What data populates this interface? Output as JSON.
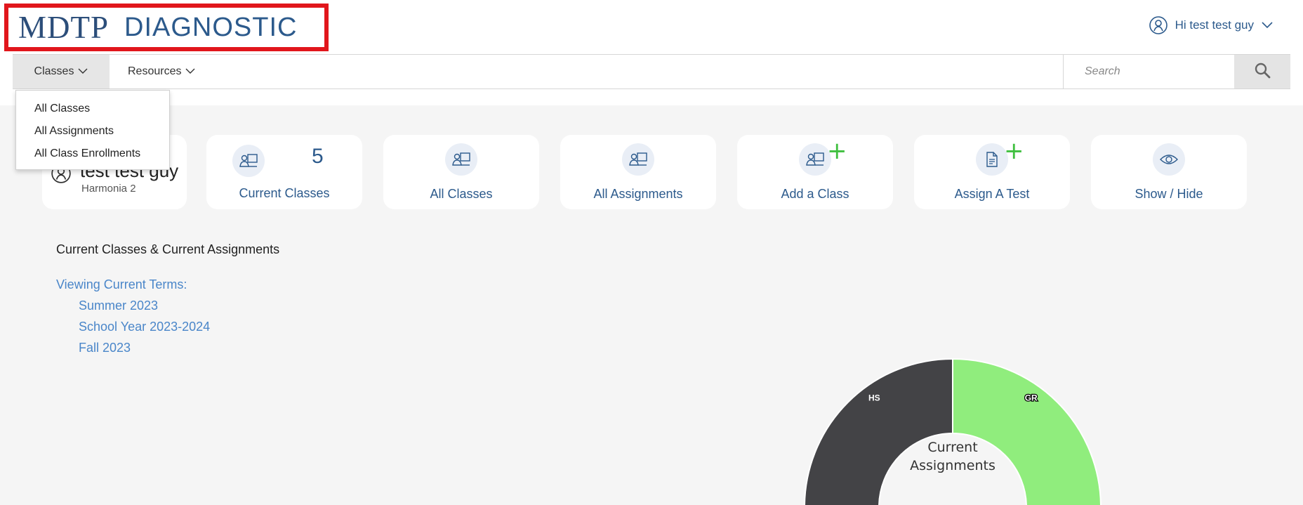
{
  "header": {
    "logo_mdtp": "MDTP",
    "logo_diagnostic": "DIAGNOSTIC",
    "greeting": "Hi test test guy",
    "user_icon": "user-circle-icon",
    "chevron_icon": "chevron-down-icon",
    "highlight_color": "#e1161c"
  },
  "nav": {
    "classes_label": "Classes",
    "resources_label": "Resources",
    "search_placeholder": "Search",
    "search_icon": "search-icon"
  },
  "dropdown": {
    "items": [
      "All Classes",
      "All Assignments",
      "All Class Enrollments"
    ]
  },
  "profile": {
    "name": "test test guy",
    "school": "Harmonia 2"
  },
  "cards": {
    "current_classes": {
      "count": "5",
      "label": "Current Classes"
    },
    "all_classes": {
      "label": "All Classes"
    },
    "all_assignments": {
      "label": "All Assignments"
    },
    "add_class": {
      "label": "Add a Class"
    },
    "assign_test": {
      "label": "Assign A Test"
    },
    "show_hide": {
      "label": "Show / Hide"
    }
  },
  "section": {
    "title": "Current Classes & Current Assignments",
    "terms_label": "Viewing Current Terms:",
    "terms": [
      "Summer 2023",
      "School Year 2023-2024",
      "Fall 2023"
    ]
  },
  "chart_data": {
    "type": "pie",
    "subtype": "half-donut",
    "center_label": "Current Assignments",
    "slices": [
      {
        "label": "HS",
        "value": 1,
        "color": "#434346"
      },
      {
        "label": "GR",
        "value": 1,
        "color": "#90ed7d"
      }
    ]
  }
}
